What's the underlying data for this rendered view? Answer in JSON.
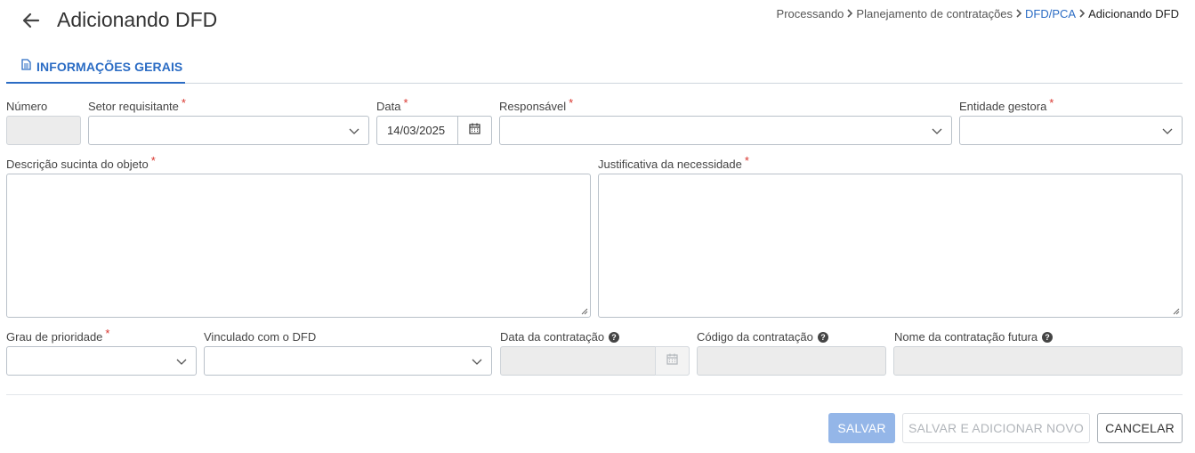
{
  "header": {
    "title": "Adicionando DFD",
    "breadcrumb": [
      {
        "label": "Processando",
        "type": "plain"
      },
      {
        "label": "Planejamento de contratações",
        "type": "plain"
      },
      {
        "label": "DFD/PCA",
        "type": "link"
      },
      {
        "label": "Adicionando DFD",
        "type": "current"
      }
    ]
  },
  "tabs": [
    {
      "label": "INFORMAÇÕES GERAIS",
      "icon": "document-icon",
      "active": true
    }
  ],
  "form": {
    "numero": {
      "label": "Número",
      "value": ""
    },
    "setor_requisitante": {
      "label": "Setor requisitante",
      "required_mark": "*",
      "value": ""
    },
    "data": {
      "label": "Data",
      "required_mark": "*",
      "value": "14/03/2025"
    },
    "responsavel": {
      "label": "Responsável",
      "required_mark": "*",
      "value": ""
    },
    "entidade_gestora": {
      "label": "Entidade gestora",
      "required_mark": "*",
      "value": ""
    },
    "descricao": {
      "label": "Descrição sucinta do objeto",
      "required_mark": "*",
      "value": ""
    },
    "justificativa": {
      "label": "Justificativa da necessidade",
      "required_mark": "*",
      "value": ""
    },
    "grau_prioridade": {
      "label": "Grau de prioridade",
      "required_mark": "*",
      "value": ""
    },
    "vinculado_dfd": {
      "label": "Vinculado com o DFD",
      "value": ""
    },
    "data_contratacao": {
      "label": "Data da contratação",
      "value": ""
    },
    "codigo_contratacao": {
      "label": "Código da contratação",
      "value": ""
    },
    "nome_contratacao_futura": {
      "label": "Nome da contratação futura",
      "value": ""
    }
  },
  "actions": {
    "save": "SALVAR",
    "save_and_new": "SALVAR E ADICIONAR NOVO",
    "cancel": "CANCELAR"
  },
  "colors": {
    "accent": "#2b6cc4",
    "required": "#d9362f",
    "save_button_disabled": "#94b6e8",
    "disabled_field": "#ececec"
  }
}
